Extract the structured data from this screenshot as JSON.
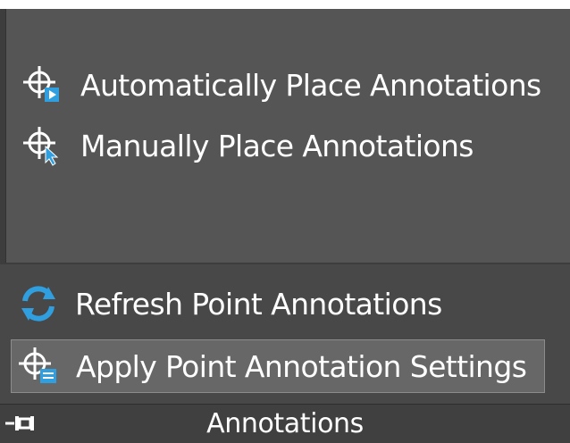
{
  "panel": {
    "items": [
      {
        "label": "Automatically Place  Annotations",
        "icon": "crosshair-play-icon"
      },
      {
        "label": "Manually Place Annotations",
        "icon": "crosshair-cursor-icon"
      },
      {
        "label": "Refresh Point Annotations",
        "icon": "refresh-icon"
      },
      {
        "label": "Apply Point Annotation Settings",
        "icon": "crosshair-settings-icon"
      }
    ],
    "footer_title": "Annotations"
  },
  "colors": {
    "background": "#555555",
    "highlight": "#676767",
    "accent_blue": "#2f9fe0",
    "text": "#ffffff"
  }
}
